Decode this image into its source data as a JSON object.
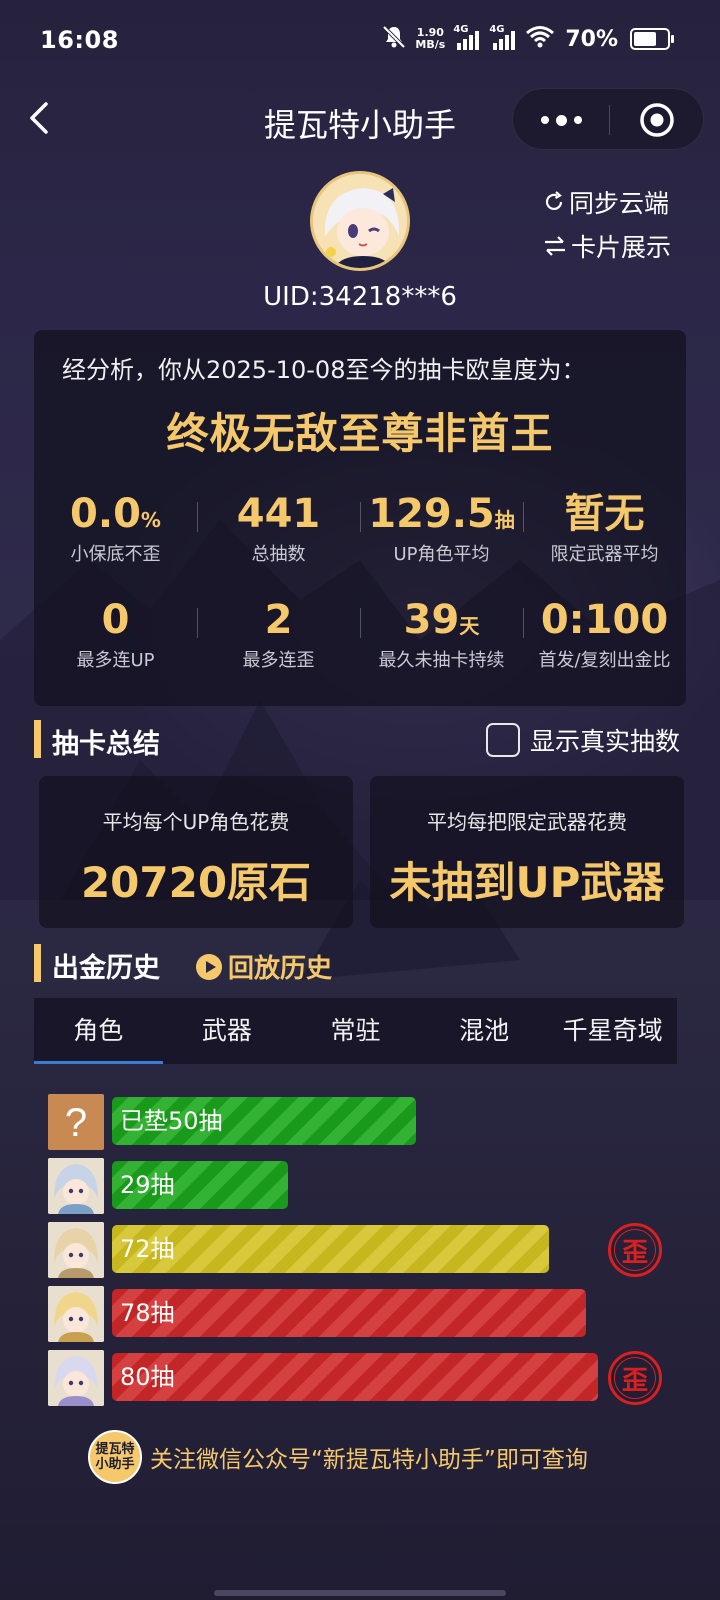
{
  "status_bar": {
    "time": "16:08",
    "speed_value": "1.90",
    "speed_unit": "MB/s",
    "network_1": "4G",
    "network_2": "4G",
    "battery_text": "70%",
    "battery_level": 0.7
  },
  "nav": {
    "title": "提瓦特小助手"
  },
  "profile": {
    "uid": "UID:34218***6",
    "sync_label": "同步云端",
    "card_label": "卡片展示"
  },
  "analysis": {
    "intro": "经分析，你从2025-10-08至今的抽卡欧皇度为：",
    "title": "终极无敌至尊非酋王",
    "stats": [
      {
        "value": "0.0",
        "unit": "%",
        "label": "小保底不歪"
      },
      {
        "value": "441",
        "unit": "",
        "label": "总抽数"
      },
      {
        "value": "129.5",
        "unit": "抽",
        "label": "UP角色平均"
      },
      {
        "value": "暂无",
        "unit": "",
        "label": "限定武器平均"
      },
      {
        "value": "0",
        "unit": "",
        "label": "最多连UP"
      },
      {
        "value": "2",
        "unit": "",
        "label": "最多连歪"
      },
      {
        "value": "39",
        "unit": "天",
        "label": "最久未抽卡持续"
      },
      {
        "value": "0:100",
        "unit": "",
        "label": "首发/复刻出金比"
      }
    ]
  },
  "summary": {
    "title": "抽卡总结",
    "toggle_label": "显示真实抽数",
    "cards": [
      {
        "label": "平均每个UP角色花费",
        "value": "20720原石"
      },
      {
        "label": "平均每把限定武器花费",
        "value": "未抽到UP武器"
      }
    ]
  },
  "history": {
    "title": "出金历史",
    "replay_label": "回放历史",
    "tabs": [
      "角色",
      "武器",
      "常驻",
      "混池",
      "千星奇域"
    ],
    "active_tab": "角色",
    "max_pulls": 80,
    "wai_badge": "歪",
    "rows": [
      {
        "label": "已垫50抽",
        "pulls": 50,
        "color": "green",
        "wai": false,
        "portrait": "unknown"
      },
      {
        "label": "29抽",
        "pulls": 29,
        "color": "green",
        "wai": false,
        "portrait": "character"
      },
      {
        "label": "72抽",
        "pulls": 72,
        "color": "yellow",
        "wai": true,
        "portrait": "character"
      },
      {
        "label": "78抽",
        "pulls": 78,
        "color": "red",
        "wai": false,
        "portrait": "character"
      },
      {
        "label": "80抽",
        "pulls": 80,
        "color": "red",
        "wai": true,
        "portrait": "character"
      }
    ]
  },
  "footer": {
    "logo_text": "提瓦特小助手",
    "text": "关注微信公众号“新提瓦特小助手”即可查询"
  },
  "colors": {
    "accent_gold": "#f5c96b",
    "bar_green": "#1a9a1a",
    "bar_yellow": "#c7b71e",
    "bar_red": "#c22626",
    "tab_underline": "#3a7bd5"
  }
}
